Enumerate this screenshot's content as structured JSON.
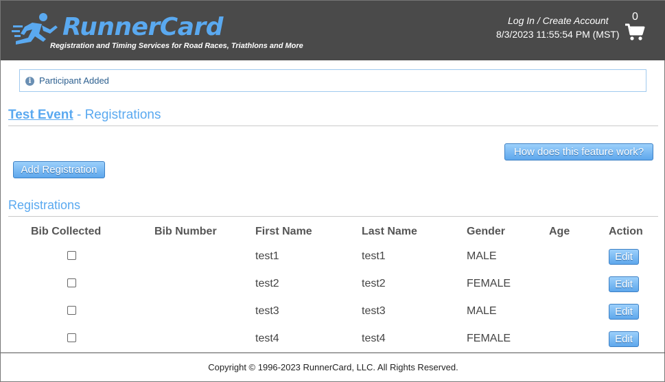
{
  "header": {
    "brand": "RunnerCard",
    "tagline": "Registration and Timing Services for Road Races, Triathlons and More",
    "login_link": "Log In / Create Account",
    "datetime": "8/3/2023 11:55:54 PM (MST)",
    "cart_count": "0",
    "cart_icon": "shopping-cart-icon",
    "logo_icon": "runner-icon"
  },
  "alert": {
    "icon": "info-icon",
    "message": "Participant Added"
  },
  "page": {
    "event_name": "Test Event",
    "heading_suffix": " - Registrations",
    "help_button": "How does this feature work?",
    "add_button": "Add Registration"
  },
  "registrations": {
    "title": "Registrations",
    "columns": [
      "Bib Collected",
      "Bib Number",
      "First Name",
      "Last Name",
      "Gender",
      "Age",
      "Action"
    ],
    "rows": [
      {
        "bib_collected": false,
        "bib_number": "",
        "first_name": "test1",
        "last_name": "test1",
        "gender": "MALE",
        "age": "",
        "action": "Edit"
      },
      {
        "bib_collected": false,
        "bib_number": "",
        "first_name": "test2",
        "last_name": "test2",
        "gender": "FEMALE",
        "age": "",
        "action": "Edit"
      },
      {
        "bib_collected": false,
        "bib_number": "",
        "first_name": "test3",
        "last_name": "test3",
        "gender": "MALE",
        "age": "",
        "action": "Edit"
      },
      {
        "bib_collected": false,
        "bib_number": "",
        "first_name": "test4",
        "last_name": "test4",
        "gender": "FEMALE",
        "age": "",
        "action": "Edit"
      }
    ]
  },
  "footer": {
    "copyright": "Copyright © 1996-2023 RunnerCard, LLC. All Rights Reserved."
  },
  "colors": {
    "header_bg": "#4a4a4a",
    "brand_blue": "#5aa9f0",
    "button_blue": "#5ea7ec",
    "alert_border": "#9fc9ee"
  }
}
